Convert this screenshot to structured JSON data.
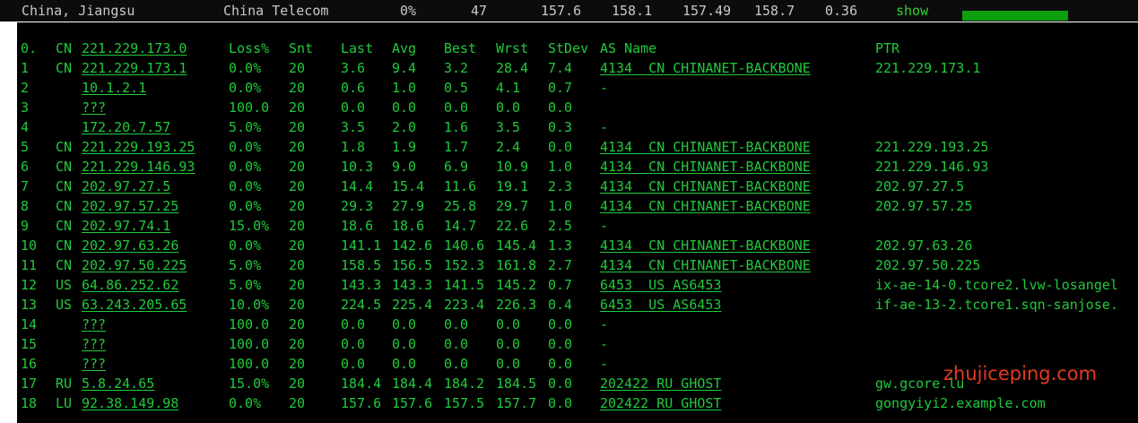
{
  "summary": {
    "location": "China, Jiangsu",
    "isp": "China Telecom",
    "loss": "0%",
    "snt": "47",
    "last": "157.6",
    "avg": "158.1",
    "best": "157.49",
    "wrst": "158.7",
    "stdev": "0.36",
    "show_label": "show"
  },
  "colors": {
    "text": "#22c93c",
    "background": "#000000",
    "watermark": "#e43a1f",
    "bar": "#0e9f0e"
  },
  "headers": {
    "num": "0.",
    "cc": "CN",
    "host": "221.229.173.0",
    "loss": "Loss%",
    "snt": "Snt",
    "last": "Last",
    "avg": "Avg",
    "best": "Best",
    "wrst": "Wrst",
    "stdev": "StDev",
    "as": "AS Name",
    "ptr": "PTR"
  },
  "rows": [
    {
      "num": "1",
      "cc": "CN",
      "host": "221.229.173.1",
      "loss": "0.0%",
      "snt": "20",
      "last": "3.6",
      "avg": "9.4",
      "best": "3.2",
      "wrst": "28.4",
      "stdev": "7.4",
      "as": "4134  CN CHINANET-BACKBONE",
      "ptr": "221.229.173.1"
    },
    {
      "num": "2",
      "cc": "",
      "host": "10.1.2.1",
      "loss": "0.0%",
      "snt": "20",
      "last": "0.6",
      "avg": "1.0",
      "best": "0.5",
      "wrst": "4.1",
      "stdev": "0.7",
      "as": "-",
      "ptr": ""
    },
    {
      "num": "3",
      "cc": "",
      "host": "???",
      "loss": "100.0",
      "snt": "20",
      "last": "0.0",
      "avg": "0.0",
      "best": "0.0",
      "wrst": "0.0",
      "stdev": "0.0",
      "as": "",
      "ptr": ""
    },
    {
      "num": "4",
      "cc": "",
      "host": "172.20.7.57",
      "loss": "5.0%",
      "snt": "20",
      "last": "3.5",
      "avg": "2.0",
      "best": "1.6",
      "wrst": "3.5",
      "stdev": "0.3",
      "as": "-",
      "ptr": ""
    },
    {
      "num": "5",
      "cc": "CN",
      "host": "221.229.193.25",
      "loss": "0.0%",
      "snt": "20",
      "last": "1.8",
      "avg": "1.9",
      "best": "1.7",
      "wrst": "2.4",
      "stdev": "0.0",
      "as": "4134  CN CHINANET-BACKBONE",
      "ptr": "221.229.193.25"
    },
    {
      "num": "6",
      "cc": "CN",
      "host": "221.229.146.93",
      "loss": "0.0%",
      "snt": "20",
      "last": "10.3",
      "avg": "9.0",
      "best": "6.9",
      "wrst": "10.9",
      "stdev": "1.0",
      "as": "4134  CN CHINANET-BACKBONE",
      "ptr": "221.229.146.93"
    },
    {
      "num": "7",
      "cc": "CN",
      "host": "202.97.27.5",
      "loss": "0.0%",
      "snt": "20",
      "last": "14.4",
      "avg": "15.4",
      "best": "11.6",
      "wrst": "19.1",
      "stdev": "2.3",
      "as": "4134  CN CHINANET-BACKBONE",
      "ptr": "202.97.27.5"
    },
    {
      "num": "8",
      "cc": "CN",
      "host": "202.97.57.25",
      "loss": "0.0%",
      "snt": "20",
      "last": "29.3",
      "avg": "27.9",
      "best": "25.8",
      "wrst": "29.7",
      "stdev": "1.0",
      "as": "4134  CN CHINANET-BACKBONE",
      "ptr": "202.97.57.25"
    },
    {
      "num": "9",
      "cc": "CN",
      "host": "202.97.74.1",
      "loss": "15.0%",
      "snt": "20",
      "last": "18.6",
      "avg": "18.6",
      "best": "14.7",
      "wrst": "22.6",
      "stdev": "2.5",
      "as": "-",
      "ptr": ""
    },
    {
      "num": "10",
      "cc": "CN",
      "host": "202.97.63.26",
      "loss": "0.0%",
      "snt": "20",
      "last": "141.1",
      "avg": "142.6",
      "best": "140.6",
      "wrst": "145.4",
      "stdev": "1.3",
      "as": "4134  CN CHINANET-BACKBONE",
      "ptr": "202.97.63.26"
    },
    {
      "num": "11",
      "cc": "CN",
      "host": "202.97.50.225",
      "loss": "5.0%",
      "snt": "20",
      "last": "158.5",
      "avg": "156.5",
      "best": "152.3",
      "wrst": "161.8",
      "stdev": "2.7",
      "as": "4134  CN CHINANET-BACKBONE",
      "ptr": "202.97.50.225"
    },
    {
      "num": "12",
      "cc": "US",
      "host": "64.86.252.62",
      "loss": "5.0%",
      "snt": "20",
      "last": "143.3",
      "avg": "143.3",
      "best": "141.5",
      "wrst": "145.2",
      "stdev": "0.7",
      "as": "6453  US AS6453",
      "ptr": "ix-ae-14-0.tcore2.lvw-losangel"
    },
    {
      "num": "13",
      "cc": "US",
      "host": "63.243.205.65",
      "loss": "10.0%",
      "snt": "20",
      "last": "224.5",
      "avg": "225.4",
      "best": "223.4",
      "wrst": "226.3",
      "stdev": "0.4",
      "as": "6453  US AS6453",
      "ptr": "if-ae-13-2.tcore1.sqn-sanjose."
    },
    {
      "num": "14",
      "cc": "",
      "host": "???",
      "loss": "100.0",
      "snt": "20",
      "last": "0.0",
      "avg": "0.0",
      "best": "0.0",
      "wrst": "0.0",
      "stdev": "0.0",
      "as": "-",
      "ptr": ""
    },
    {
      "num": "15",
      "cc": "",
      "host": "???",
      "loss": "100.0",
      "snt": "20",
      "last": "0.0",
      "avg": "0.0",
      "best": "0.0",
      "wrst": "0.0",
      "stdev": "0.0",
      "as": "-",
      "ptr": ""
    },
    {
      "num": "16",
      "cc": "",
      "host": "???",
      "loss": "100.0",
      "snt": "20",
      "last": "0.0",
      "avg": "0.0",
      "best": "0.0",
      "wrst": "0.0",
      "stdev": "0.0",
      "as": "-",
      "ptr": ""
    },
    {
      "num": "17",
      "cc": "RU",
      "host": "5.8.24.65",
      "loss": "15.0%",
      "snt": "20",
      "last": "184.4",
      "avg": "184.4",
      "best": "184.2",
      "wrst": "184.5",
      "stdev": "0.0",
      "as": "202422 RU GHOST",
      "ptr": "gw.gcore.lu"
    },
    {
      "num": "18",
      "cc": "LU",
      "host": "92.38.149.98",
      "loss": "0.0%",
      "snt": "20",
      "last": "157.6",
      "avg": "157.6",
      "best": "157.5",
      "wrst": "157.7",
      "stdev": "0.0",
      "as": "202422 RU GHOST",
      "ptr": "gongyiyi2.example.com"
    }
  ],
  "watermark": "zhujiceping.com"
}
